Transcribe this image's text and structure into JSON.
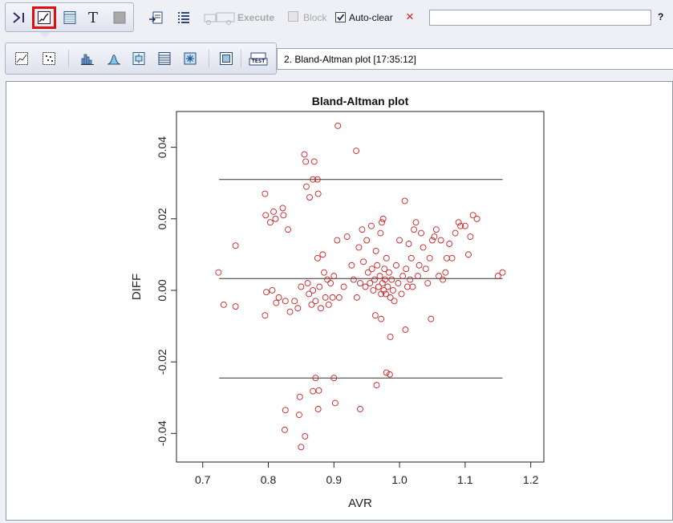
{
  "toolbar": {
    "mode_text_glyph": "T",
    "execute_label": "Execute",
    "block_label": "Block",
    "autoclear_label": "Auto-clear",
    "autoclear_checked": true,
    "close_glyph": "×",
    "help_glyph": "?",
    "command_value": ""
  },
  "toolbar2": {
    "test_label": "TEST",
    "plot_title_value": "2. Bland-Altman plot [17:35:12]"
  },
  "chart_data": {
    "type": "scatter",
    "title": "Bland-Altman plot",
    "xlabel": "AVR",
    "ylabel": "DIFF",
    "xlim": [
      0.66,
      1.22
    ],
    "ylim": [
      -0.048,
      0.05
    ],
    "xticks": [
      "0.7",
      "0.8",
      "0.9",
      "1.0",
      "1.1",
      "1.2"
    ],
    "yticks": [
      "-0.04",
      "-0.02",
      "0.00",
      "0.02",
      "0.04"
    ],
    "reference_lines": [
      {
        "y": 0.031,
        "x_from": 0.725,
        "x_to": 1.157
      },
      {
        "y": 0.0033,
        "x_from": 0.725,
        "x_to": 1.157
      },
      {
        "y": -0.0245,
        "x_from": 0.725,
        "x_to": 1.157
      }
    ],
    "point_color": "#cc2222",
    "points": [
      [
        0.906,
        0.046
      ],
      [
        0.934,
        0.039
      ],
      [
        0.855,
        0.038
      ],
      [
        0.857,
        0.036
      ],
      [
        0.87,
        0.036
      ],
      [
        0.875,
        0.031
      ],
      [
        0.868,
        0.031
      ],
      [
        0.858,
        0.029
      ],
      [
        0.876,
        0.027
      ],
      [
        0.863,
        0.026
      ],
      [
        0.795,
        0.027
      ],
      [
        0.796,
        0.021
      ],
      [
        0.811,
        0.02
      ],
      [
        0.803,
        0.019
      ],
      [
        0.822,
        0.023
      ],
      [
        0.808,
        0.022
      ],
      [
        0.75,
        0.0125
      ],
      [
        0.83,
        0.017
      ],
      [
        0.823,
        0.021
      ],
      [
        0.724,
        0.005
      ],
      [
        0.732,
        -0.004
      ],
      [
        0.75,
        -0.0045
      ],
      [
        0.797,
        -0.0005
      ],
      [
        0.795,
        -0.007
      ],
      [
        0.806,
        0.0
      ],
      [
        0.816,
        -0.002
      ],
      [
        0.826,
        -0.003
      ],
      [
        0.812,
        -0.0035
      ],
      [
        0.833,
        -0.006
      ],
      [
        0.84,
        -0.003
      ],
      [
        0.845,
        -0.005
      ],
      [
        0.85,
        0.001
      ],
      [
        0.86,
        0.002
      ],
      [
        0.862,
        -0.001
      ],
      [
        0.866,
        -0.004
      ],
      [
        0.868,
        0.0
      ],
      [
        0.872,
        -0.003
      ],
      [
        0.875,
        0.009
      ],
      [
        0.878,
        0.001
      ],
      [
        0.88,
        -0.005
      ],
      [
        0.883,
        0.01
      ],
      [
        0.885,
        0.005
      ],
      [
        0.887,
        -0.002
      ],
      [
        0.89,
        0.003
      ],
      [
        0.892,
        -0.004
      ],
      [
        0.895,
        0.002
      ],
      [
        0.898,
        -0.002
      ],
      [
        0.9,
        0.004
      ],
      [
        0.905,
        0.014
      ],
      [
        0.908,
        -0.002
      ],
      [
        0.915,
        0.001
      ],
      [
        0.92,
        0.015
      ],
      [
        0.927,
        0.007
      ],
      [
        0.93,
        0.003
      ],
      [
        0.935,
        -0.002
      ],
      [
        0.938,
        0.012
      ],
      [
        0.94,
        0.002
      ],
      [
        0.943,
        0.017
      ],
      [
        0.945,
        0.008
      ],
      [
        0.948,
        0.001
      ],
      [
        0.95,
        0.014
      ],
      [
        0.952,
        0.005
      ],
      [
        0.955,
        0.002
      ],
      [
        0.957,
        0.018
      ],
      [
        0.958,
        0.006
      ],
      [
        0.96,
        0.0
      ],
      [
        0.962,
        0.003
      ],
      [
        0.964,
        0.011
      ],
      [
        0.966,
        0.007
      ],
      [
        0.968,
        0.001
      ],
      [
        0.97,
        0.004
      ],
      [
        0.971,
        0.016
      ],
      [
        0.972,
        -0.001
      ],
      [
        0.973,
        0.019
      ],
      [
        0.974,
        0.002
      ],
      [
        0.975,
        0.02
      ],
      [
        0.976,
        0.0
      ],
      [
        0.977,
        0.006
      ],
      [
        0.978,
        0.003
      ],
      [
        0.979,
        -0.001
      ],
      [
        0.98,
        0.009
      ],
      [
        0.982,
        0.001
      ],
      [
        0.984,
        0.005
      ],
      [
        0.986,
        -0.002
      ],
      [
        0.988,
        0.003
      ],
      [
        0.99,
        0.0
      ],
      [
        0.992,
        -0.003
      ],
      [
        0.995,
        0.007
      ],
      [
        0.998,
        0.002
      ],
      [
        1.0,
        0.014
      ],
      [
        1.003,
        -0.001
      ],
      [
        1.005,
        0.004
      ],
      [
        1.008,
        0.025
      ],
      [
        1.01,
        0.006
      ],
      [
        1.012,
        0.001
      ],
      [
        1.014,
        0.013
      ],
      [
        1.016,
        0.003
      ],
      [
        1.018,
        0.009
      ],
      [
        1.02,
        0.001
      ],
      [
        1.022,
        0.017
      ],
      [
        1.025,
        0.019
      ],
      [
        1.028,
        0.004
      ],
      [
        1.03,
        0.007
      ],
      [
        1.033,
        0.016
      ],
      [
        1.036,
        0.012
      ],
      [
        1.04,
        0.006
      ],
      [
        1.043,
        0.002
      ],
      [
        1.046,
        0.009
      ],
      [
        1.05,
        0.014
      ],
      [
        1.053,
        0.015
      ],
      [
        1.056,
        0.017
      ],
      [
        1.06,
        0.004
      ],
      [
        1.063,
        0.014
      ],
      [
        1.066,
        0.003
      ],
      [
        1.07,
        0.005
      ],
      [
        1.072,
        0.009
      ],
      [
        1.076,
        0.013
      ],
      [
        1.08,
        0.009
      ],
      [
        1.085,
        0.016
      ],
      [
        1.09,
        0.019
      ],
      [
        1.093,
        0.018
      ],
      [
        1.1,
        0.018
      ],
      [
        1.105,
        0.01
      ],
      [
        1.108,
        0.015
      ],
      [
        1.112,
        0.021
      ],
      [
        1.118,
        0.02
      ],
      [
        1.15,
        0.004
      ],
      [
        1.157,
        0.005
      ],
      [
        0.963,
        -0.007
      ],
      [
        0.972,
        -0.008
      ],
      [
        0.986,
        -0.013
      ],
      [
        1.009,
        -0.011
      ],
      [
        1.048,
        -0.008
      ],
      [
        0.98,
        -0.023
      ],
      [
        0.985,
        -0.0235
      ],
      [
        0.965,
        -0.0265
      ],
      [
        0.9,
        -0.0245
      ],
      [
        0.872,
        -0.0245
      ],
      [
        0.868,
        -0.0282
      ],
      [
        0.877,
        -0.028
      ],
      [
        0.848,
        -0.0298
      ],
      [
        0.902,
        -0.0315
      ],
      [
        0.876,
        -0.0332
      ],
      [
        0.94,
        -0.0332
      ],
      [
        0.826,
        -0.0335
      ],
      [
        0.847,
        -0.0348
      ],
      [
        0.825,
        -0.039
      ],
      [
        0.856,
        -0.0408
      ],
      [
        0.85,
        -0.0438
      ]
    ]
  }
}
